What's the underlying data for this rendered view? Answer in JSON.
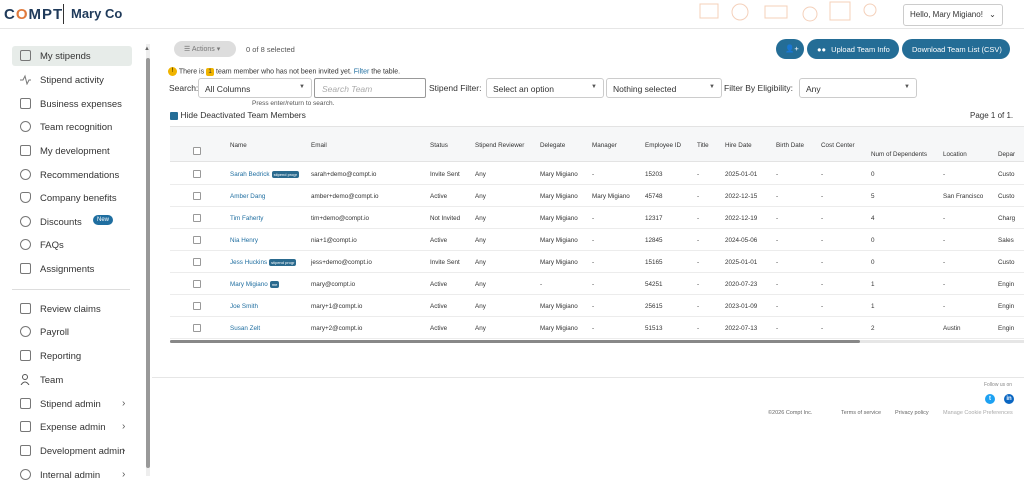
{
  "header": {
    "logo": "COMPT",
    "company": "Mary Co",
    "greeting": "Hello, Mary Migiano!"
  },
  "sidebar": {
    "items": [
      {
        "label": "My stipends"
      },
      {
        "label": "Stipend activity"
      },
      {
        "label": "Business expenses"
      },
      {
        "label": "Team recognition"
      },
      {
        "label": "My development"
      },
      {
        "label": "Recommendations"
      },
      {
        "label": "Company benefits"
      },
      {
        "label": "Discounts",
        "badge": "New"
      },
      {
        "label": "FAQs"
      },
      {
        "label": "Assignments"
      },
      {
        "label": "Review claims"
      },
      {
        "label": "Payroll"
      },
      {
        "label": "Reporting"
      },
      {
        "label": "Team"
      },
      {
        "label": "Stipend admin"
      },
      {
        "label": "Expense admin"
      },
      {
        "label": "Development admin"
      },
      {
        "label": "Internal admin"
      }
    ]
  },
  "toolbar": {
    "actions_label": "Actions",
    "selected_text": "0 of 8 selected",
    "upload_label": "Upload Team Info",
    "download_label": "Download Team List (CSV)"
  },
  "notice": {
    "prefix": "There is",
    "count": "1",
    "suffix": "team member who has not been invited yet.",
    "link": "Filter",
    "tail": "the table."
  },
  "filters": {
    "search_label": "Search:",
    "search_column": "All Columns",
    "search_placeholder": "Search Team",
    "search_hint": "Press enter/return to search.",
    "stipend_filter_label": "Stipend Filter:",
    "stipend_filter_value": "Select an option",
    "stipend_multi_value": "Nothing selected",
    "eligibility_label": "Filter By Eligibility:",
    "eligibility_value": "Any"
  },
  "table_opts": {
    "hide_deactivated": "Hide Deactivated Team Members",
    "page_info": "Page 1 of 1."
  },
  "table": {
    "columns": [
      "Name",
      "Email",
      "Status",
      "Stipend Reviewer",
      "Delegate",
      "Manager",
      "Employee ID",
      "Title",
      "Hire Date",
      "Birth Date",
      "Cost Center",
      "Num of Dependents",
      "Location",
      "Depar"
    ],
    "rows": [
      {
        "name": "Sarah Bedrick",
        "tag": "stipend progr",
        "email": "sarah+demo@compt.io",
        "status": "Invite Sent",
        "reviewer": "Any",
        "delegate": "Mary Migiano",
        "manager": "-",
        "employee_id": "15203",
        "title": "-",
        "hire_date": "2025-01-01",
        "birth_date": "-",
        "cost_center": "-",
        "dependents": "0",
        "location": "-",
        "department": "Custo"
      },
      {
        "name": "Amber Dang",
        "tag": "",
        "email": "amber+demo@compt.io",
        "status": "Active",
        "reviewer": "Any",
        "delegate": "Mary Migiano",
        "manager": "Mary Migiano",
        "employee_id": "45748",
        "title": "-",
        "hire_date": "2022-12-15",
        "birth_date": "-",
        "cost_center": "-",
        "dependents": "5",
        "location": "San Francisco",
        "department": "Custo"
      },
      {
        "name": "Tim Faherty",
        "tag": "",
        "email": "tim+demo@compt.io",
        "status": "Not Invited",
        "reviewer": "Any",
        "delegate": "Mary Migiano",
        "manager": "-",
        "employee_id": "12317",
        "title": "-",
        "hire_date": "2022-12-19",
        "birth_date": "-",
        "cost_center": "-",
        "dependents": "4",
        "location": "-",
        "department": "Charg"
      },
      {
        "name": "Nia Henry",
        "tag": "",
        "email": "nia+1@compt.io",
        "status": "Active",
        "reviewer": "Any",
        "delegate": "Mary Migiano",
        "manager": "-",
        "employee_id": "12845",
        "title": "-",
        "hire_date": "2024-05-06",
        "birth_date": "-",
        "cost_center": "-",
        "dependents": "0",
        "location": "-",
        "department": "Sales"
      },
      {
        "name": "Jess Huckins",
        "tag": "stipend progr",
        "email": "jess+demo@compt.io",
        "status": "Invite Sent",
        "reviewer": "Any",
        "delegate": "Mary Migiano",
        "manager": "-",
        "employee_id": "15165",
        "title": "-",
        "hire_date": "2025-01-01",
        "birth_date": "-",
        "cost_center": "-",
        "dependents": "0",
        "location": "-",
        "department": "Custo"
      },
      {
        "name": "Mary Migiano",
        "tag": "me",
        "email": "mary@compt.io",
        "status": "Active",
        "reviewer": "Any",
        "delegate": "-",
        "manager": "-",
        "employee_id": "54251",
        "title": "-",
        "hire_date": "2020-07-23",
        "birth_date": "-",
        "cost_center": "-",
        "dependents": "1",
        "location": "-",
        "department": "Engin"
      },
      {
        "name": "Joe Smith",
        "tag": "",
        "email": "mary+1@compt.io",
        "status": "Active",
        "reviewer": "Any",
        "delegate": "Mary Migiano",
        "manager": "-",
        "employee_id": "25615",
        "title": "-",
        "hire_date": "2023-01-09",
        "birth_date": "-",
        "cost_center": "-",
        "dependents": "1",
        "location": "-",
        "department": "Engin"
      },
      {
        "name": "Susan Zelt",
        "tag": "",
        "email": "mary+2@compt.io",
        "status": "Active",
        "reviewer": "Any",
        "delegate": "Mary Migiano",
        "manager": "-",
        "employee_id": "51513",
        "title": "-",
        "hire_date": "2022-07-13",
        "birth_date": "-",
        "cost_center": "-",
        "dependents": "2",
        "location": "Austin",
        "department": "Engin"
      }
    ]
  },
  "footer": {
    "follow": "Follow us on",
    "copyright": "©2026 Compt Inc.",
    "terms": "Terms of service",
    "privacy": "Privacy policy",
    "cookies": "Manage Cookie Preferences"
  },
  "colors": {
    "accent": "#246d96",
    "brand": "#1f3a5a",
    "warning": "#f0b400",
    "twitter": "#1da1f2",
    "linkedin": "#0a66c2"
  }
}
